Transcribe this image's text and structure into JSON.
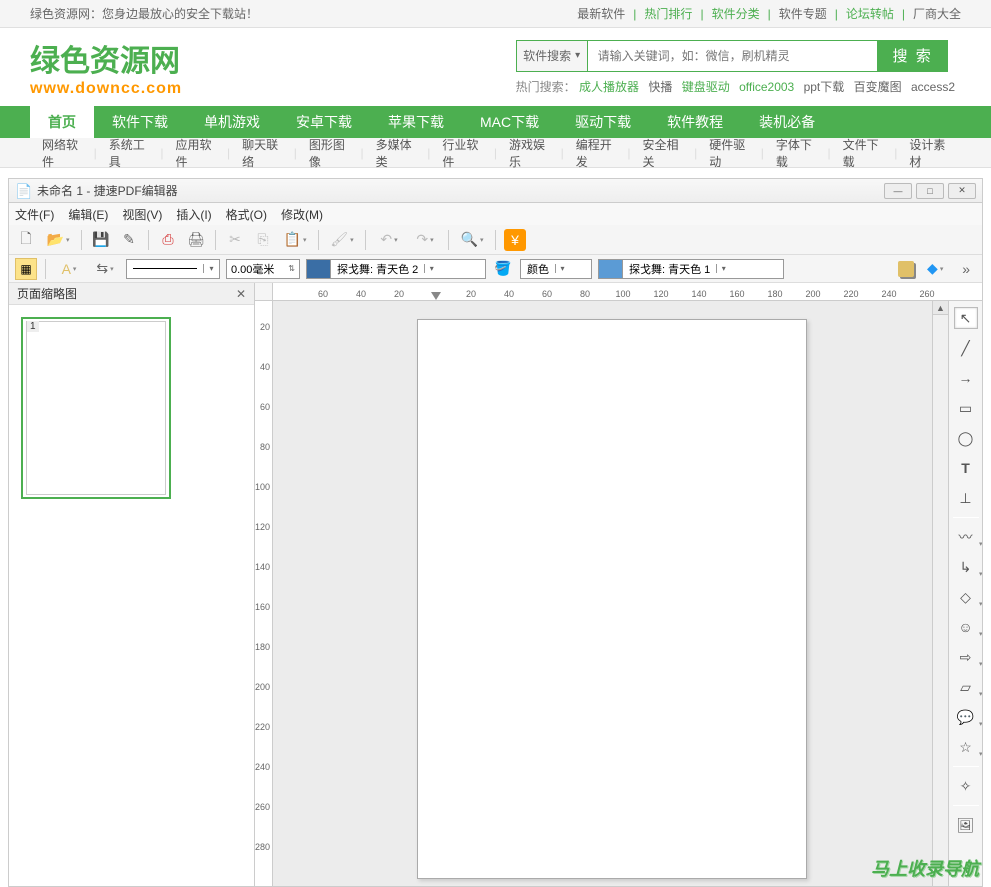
{
  "topbar": {
    "tagline": "绿色资源网：您身边最放心的安全下载站！",
    "links": {
      "latest": "最新软件",
      "hot_rank": "热门排行",
      "categories": "软件分类",
      "topics": "软件专题",
      "forum": "论坛转帖",
      "vendors": "厂商大全"
    }
  },
  "logo": {
    "main": "绿色资源网",
    "sub": "www.downcc.com"
  },
  "search": {
    "type": "软件搜索",
    "placeholder": "请输入关键词，如：微信，刷机精灵",
    "button": "搜 索",
    "hot_label": "热门搜索：",
    "hot_links": {
      "l1": "成人播放器",
      "l2": "快播",
      "l3": "键盘驱动",
      "l4": "office2003",
      "l5": "ppt下载",
      "l6": "百变魔图",
      "l7": "access2"
    }
  },
  "main_nav": {
    "home": "首页",
    "soft": "软件下载",
    "single": "单机游戏",
    "android": "安卓下载",
    "apple": "苹果下载",
    "mac": "MAC下载",
    "driver": "驱动下载",
    "tutorial": "软件教程",
    "essential": "装机必备"
  },
  "sub_nav": {
    "c1": "网络软件",
    "c2": "系统工具",
    "c3": "应用软件",
    "c4": "聊天联络",
    "c5": "图形图像",
    "c6": "多媒体类",
    "c7": "行业软件",
    "c8": "游戏娱乐",
    "c9": "编程开发",
    "c10": "安全相关",
    "c11": "硬件驱动",
    "c12": "字体下载",
    "c13": "文件下载",
    "c14": "设计素材"
  },
  "app": {
    "title": "未命名 1 - 捷速PDF编辑器",
    "menus": {
      "file": "文件(F)",
      "edit": "编辑(E)",
      "view": "视图(V)",
      "insert": "插入(I)",
      "format": "格式(O)",
      "modify": "修改(M)"
    },
    "panel": {
      "thumb_title": "页面缩略图",
      "page_num": "1"
    },
    "toolbar2": {
      "size_value": "0.00毫米",
      "color_label1": "探戈舞: 青天色 2",
      "color_mid": "颜色",
      "color_label2": "探戈舞: 青天色 1"
    },
    "ruler_h": [
      "60",
      "40",
      "20",
      "20",
      "40",
      "60",
      "80",
      "100",
      "120",
      "140",
      "160",
      "180",
      "200",
      "220",
      "240",
      "260"
    ],
    "ruler_v": [
      "20",
      "40",
      "60",
      "80",
      "100",
      "120",
      "140",
      "160",
      "180",
      "200",
      "220",
      "240",
      "260",
      "280"
    ]
  },
  "watermark": "马上收录导航"
}
